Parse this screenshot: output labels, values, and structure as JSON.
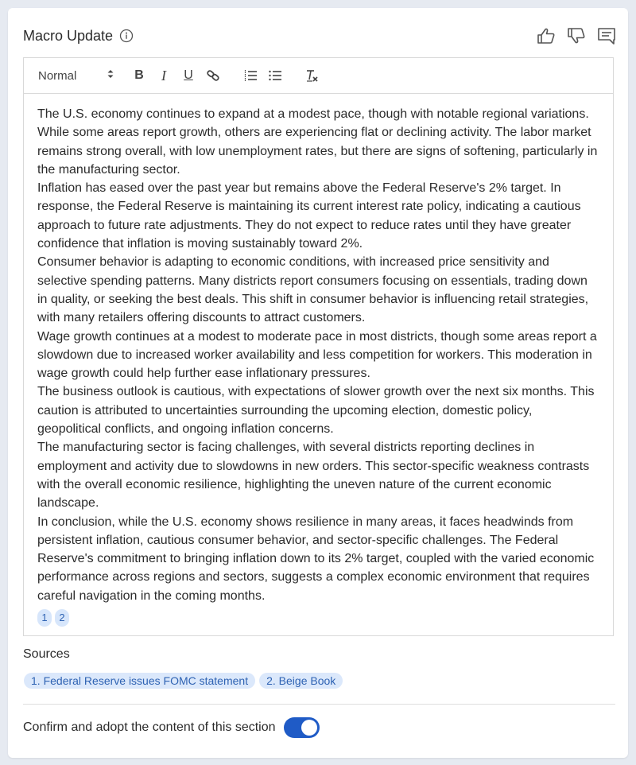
{
  "header": {
    "title": "Macro Update",
    "icons": [
      "info-icon",
      "thumbs-up-icon",
      "thumbs-down-icon",
      "comment-icon"
    ]
  },
  "toolbar": {
    "format_select": "Normal",
    "buttons": [
      "bold",
      "italic",
      "underline",
      "link",
      "ordered-list",
      "bullet-list",
      "clear-formatting"
    ],
    "bold_label": "B",
    "italic_label": "I",
    "underline_label": "U"
  },
  "content": {
    "paragraphs": [
      "The U.S. economy continues to expand at a modest pace, though with notable regional variations. While some areas report growth, others are experiencing flat or declining activity. The labor market remains strong overall, with low unemployment rates, but there are signs of softening, particularly in the manufacturing sector.",
      "Inflation has eased over the past year but remains above the Federal Reserve's 2% target. In response, the Federal Reserve is maintaining its current interest rate policy, indicating a cautious approach to future rate adjustments. They do not expect to reduce rates until they have greater confidence that inflation is moving sustainably toward 2%.",
      "Consumer behavior is adapting to economic conditions, with increased price sensitivity and selective spending patterns. Many districts report consumers focusing on essentials, trading down in quality, or seeking the best deals. This shift in consumer behavior is influencing retail strategies, with many retailers offering discounts to attract customers.",
      "Wage growth continues at a modest to moderate pace in most districts, though some areas report a slowdown due to increased worker availability and less competition for workers. This moderation in wage growth could help further ease inflationary pressures.",
      "The business outlook is cautious, with expectations of slower growth over the next six months. This caution is attributed to uncertainties surrounding the upcoming election, domestic policy, geopolitical conflicts, and ongoing inflation concerns.",
      "The manufacturing sector is facing challenges, with several districts reporting declines in employment and activity due to slowdowns in new orders. This sector-specific weakness contrasts with the overall economic resilience, highlighting the uneven nature of the current economic landscape.",
      "In conclusion, while the U.S. economy shows resilience in many areas, it faces headwinds from persistent inflation, cautious consumer behavior, and sector-specific challenges. The Federal Reserve's commitment to bringing inflation down to its 2% target, coupled with the varied economic performance across regions and sectors, suggests a complex economic environment that requires careful navigation in the coming months."
    ],
    "citations": [
      "1",
      "2"
    ]
  },
  "sources": {
    "label": "Sources",
    "items": [
      "1. Federal Reserve issues FOMC statement",
      "2. Beige Book"
    ]
  },
  "confirm": {
    "label": "Confirm and adopt the content of this section",
    "enabled": true
  },
  "colors": {
    "accent": "#1f5bc6",
    "chip_bg": "#dbe8fb",
    "chip_text": "#2f63b3",
    "page_bg": "#e6eaf1"
  }
}
